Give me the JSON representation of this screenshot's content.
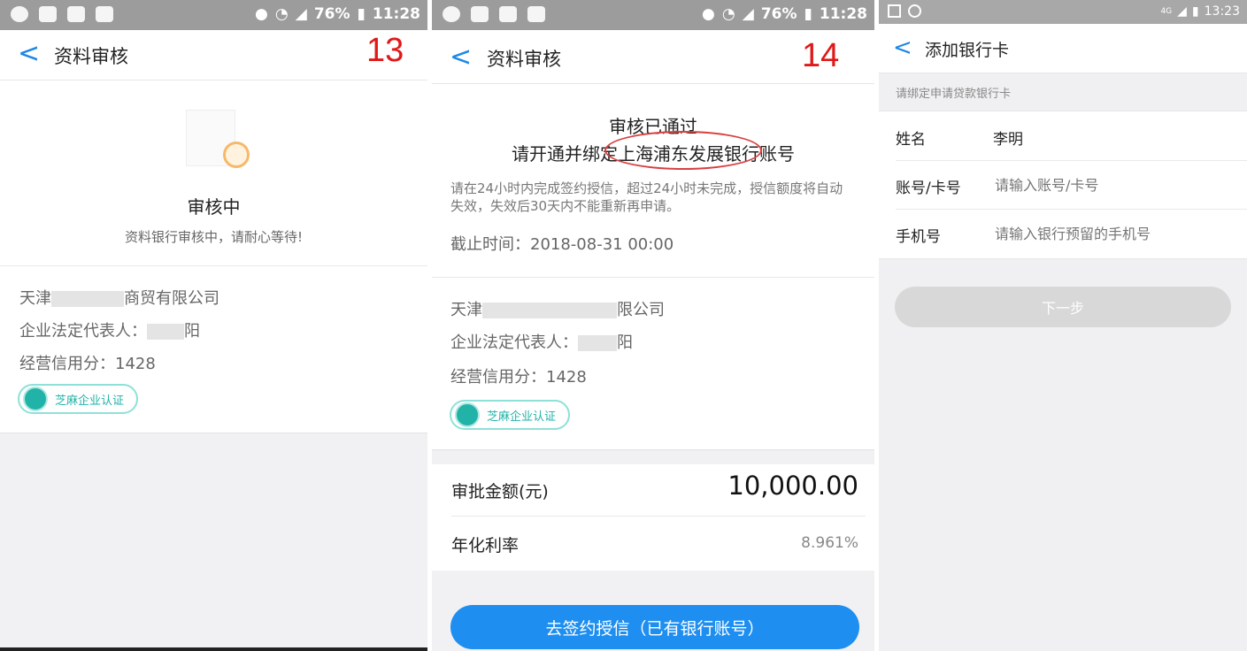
{
  "panel1": {
    "status": {
      "battery": "76%",
      "time": "11:28"
    },
    "nav": {
      "back": "<",
      "title": "资料审核",
      "page_number": "13"
    },
    "review": {
      "heading": "审核中",
      "message": "资料银行审核中，请耐心等待!"
    },
    "company": {
      "name": "天津",
      "name_tail": "商贸有限公司",
      "legal_rep_label": "企业法定代表人：",
      "legal_rep_tail": "阳",
      "credit_score": "经营信用分：1428",
      "badge": "芝麻企业认证"
    }
  },
  "panel2": {
    "status": {
      "battery": "76%",
      "time": "11:28"
    },
    "nav": {
      "back": "<",
      "title": "资料审核",
      "page_number": "14"
    },
    "approved": {
      "heading": "审核已通过",
      "bind_prefix": "请开通并绑定",
      "bank_name": "上海浦东发展银行",
      "bind_suffix": "账号",
      "notice": "请在24小时内完成签约授信，超过24小时未完成，授信额度将自动失效，失效后30天内不能重新再申请。",
      "deadline": "截止时间：2018-08-31 00:00"
    },
    "company": {
      "name": "天津",
      "name_tail": "限公司",
      "legal_rep_label": "企业法定代表人：",
      "legal_rep_tail": "阳",
      "credit_score": "经营信用分：1428",
      "badge": "芝麻企业认证"
    },
    "amount": {
      "label": "审批金额(元)",
      "value": "10,000.00"
    },
    "rate": {
      "label": "年化利率",
      "value": "8.961%"
    },
    "sign_button": "去签约授信（已有银行账号）"
  },
  "panel3": {
    "status": {
      "time": "13:23",
      "network": "4G"
    },
    "nav": {
      "back": "<",
      "title": "添加银行卡"
    },
    "hint": "请绑定申请贷款银行卡",
    "form": {
      "name_label": "姓名",
      "name_value": "李明",
      "account_label": "账号/卡号",
      "account_placeholder": "请输入账号/卡号",
      "phone_label": "手机号",
      "phone_placeholder": "请输入银行预留的手机号"
    },
    "next_button": "下一步"
  },
  "colors": {
    "accent": "#1e88e5",
    "annotation_red": "#e01818",
    "badge_teal": "#21b3a8",
    "button_blue": "#1e8ff0",
    "disabled_gray": "#d8d8d8"
  }
}
